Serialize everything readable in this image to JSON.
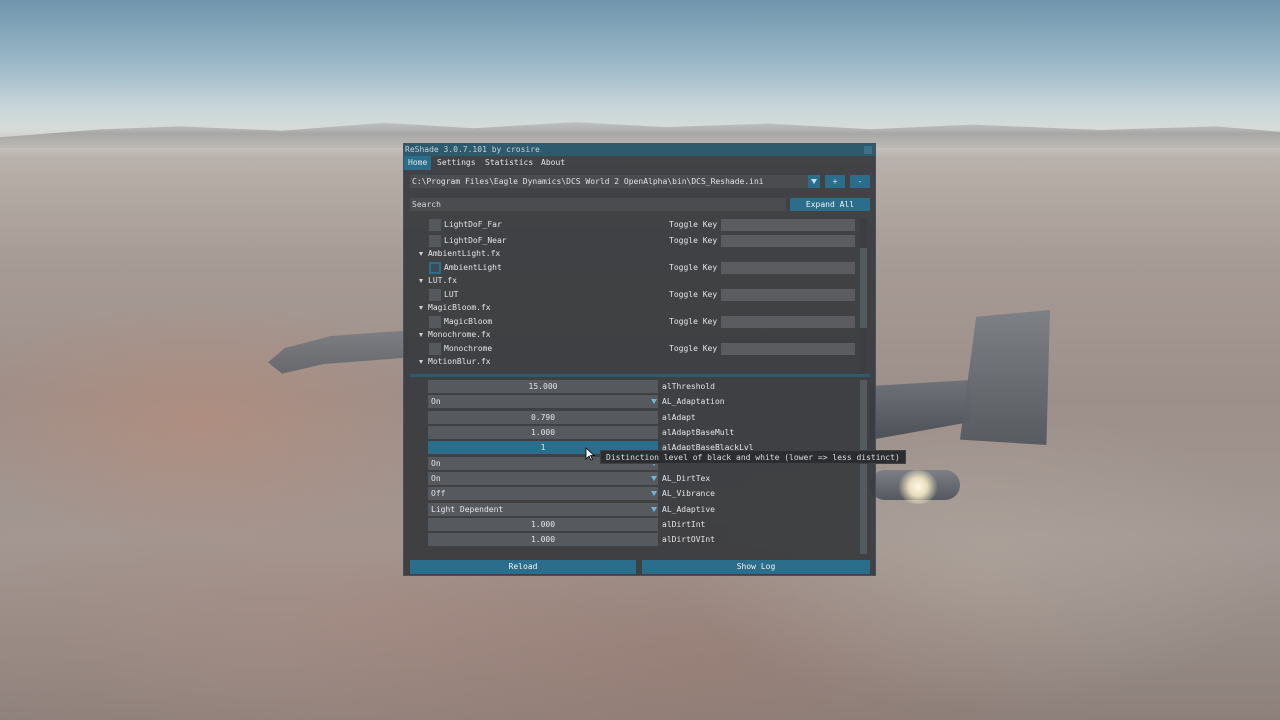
{
  "window": {
    "title": "ReShade 3.0.7.101 by crosire"
  },
  "menu": [
    "Home",
    "Settings",
    "Statistics",
    "About"
  ],
  "preset": {
    "path": "C:\\Program Files\\Eagle Dynamics\\DCS World 2 OpenAlpha\\bin\\DCS_Reshade.ini",
    "add_label": "+",
    "remove_label": "-"
  },
  "search": {
    "placeholder": "Search",
    "expand_label": "Expand All"
  },
  "techniques": [
    {
      "kind": "tech",
      "name": "LightDoF_Far",
      "toggle": "Toggle Key",
      "checked": false
    },
    {
      "kind": "tech",
      "name": "LightDoF_Near",
      "toggle": "Toggle Key",
      "checked": false
    },
    {
      "kind": "file",
      "name": "AmbientLight.fx"
    },
    {
      "kind": "tech",
      "name": "AmbientLight",
      "toggle": "Toggle Key",
      "checked": true
    },
    {
      "kind": "file",
      "name": "LUT.fx"
    },
    {
      "kind": "tech",
      "name": "LUT",
      "toggle": "Toggle Key",
      "checked": false
    },
    {
      "kind": "file",
      "name": "MagicBloom.fx"
    },
    {
      "kind": "tech",
      "name": "MagicBloom",
      "toggle": "Toggle Key",
      "checked": false
    },
    {
      "kind": "file",
      "name": "Monochrome.fx"
    },
    {
      "kind": "tech",
      "name": "Monochrome",
      "toggle": "Toggle Key",
      "checked": false
    },
    {
      "kind": "file",
      "name": "MotionBlur.fx"
    }
  ],
  "params": [
    {
      "value": "15.000",
      "type": "slider",
      "label": "alThreshold"
    },
    {
      "value": "On",
      "type": "combo",
      "label": "AL_Adaptation"
    },
    {
      "value": "0.790",
      "type": "slider",
      "label": "alAdapt"
    },
    {
      "value": "1.000",
      "type": "slider",
      "label": "alAdaptBaseMult"
    },
    {
      "value": "1",
      "type": "slider-active",
      "label": "alAdaptBaseBlackLvl"
    },
    {
      "value": "On",
      "type": "combo",
      "label": ""
    },
    {
      "value": "On",
      "type": "combo",
      "label": "AL_DirtTex"
    },
    {
      "value": "Off",
      "type": "combo",
      "label": "AL_Vibrance"
    },
    {
      "value": "Light Dependent",
      "type": "combo",
      "label": "AL_Adaptive"
    },
    {
      "value": "1.000",
      "type": "slider",
      "label": "alDirtInt"
    },
    {
      "value": "1.000",
      "type": "slider",
      "label": "alDirtOVInt"
    }
  ],
  "tooltip": "Distinction level of black and white (lower => less distinct)",
  "buttons": {
    "reload": "Reload",
    "show_log": "Show Log"
  }
}
